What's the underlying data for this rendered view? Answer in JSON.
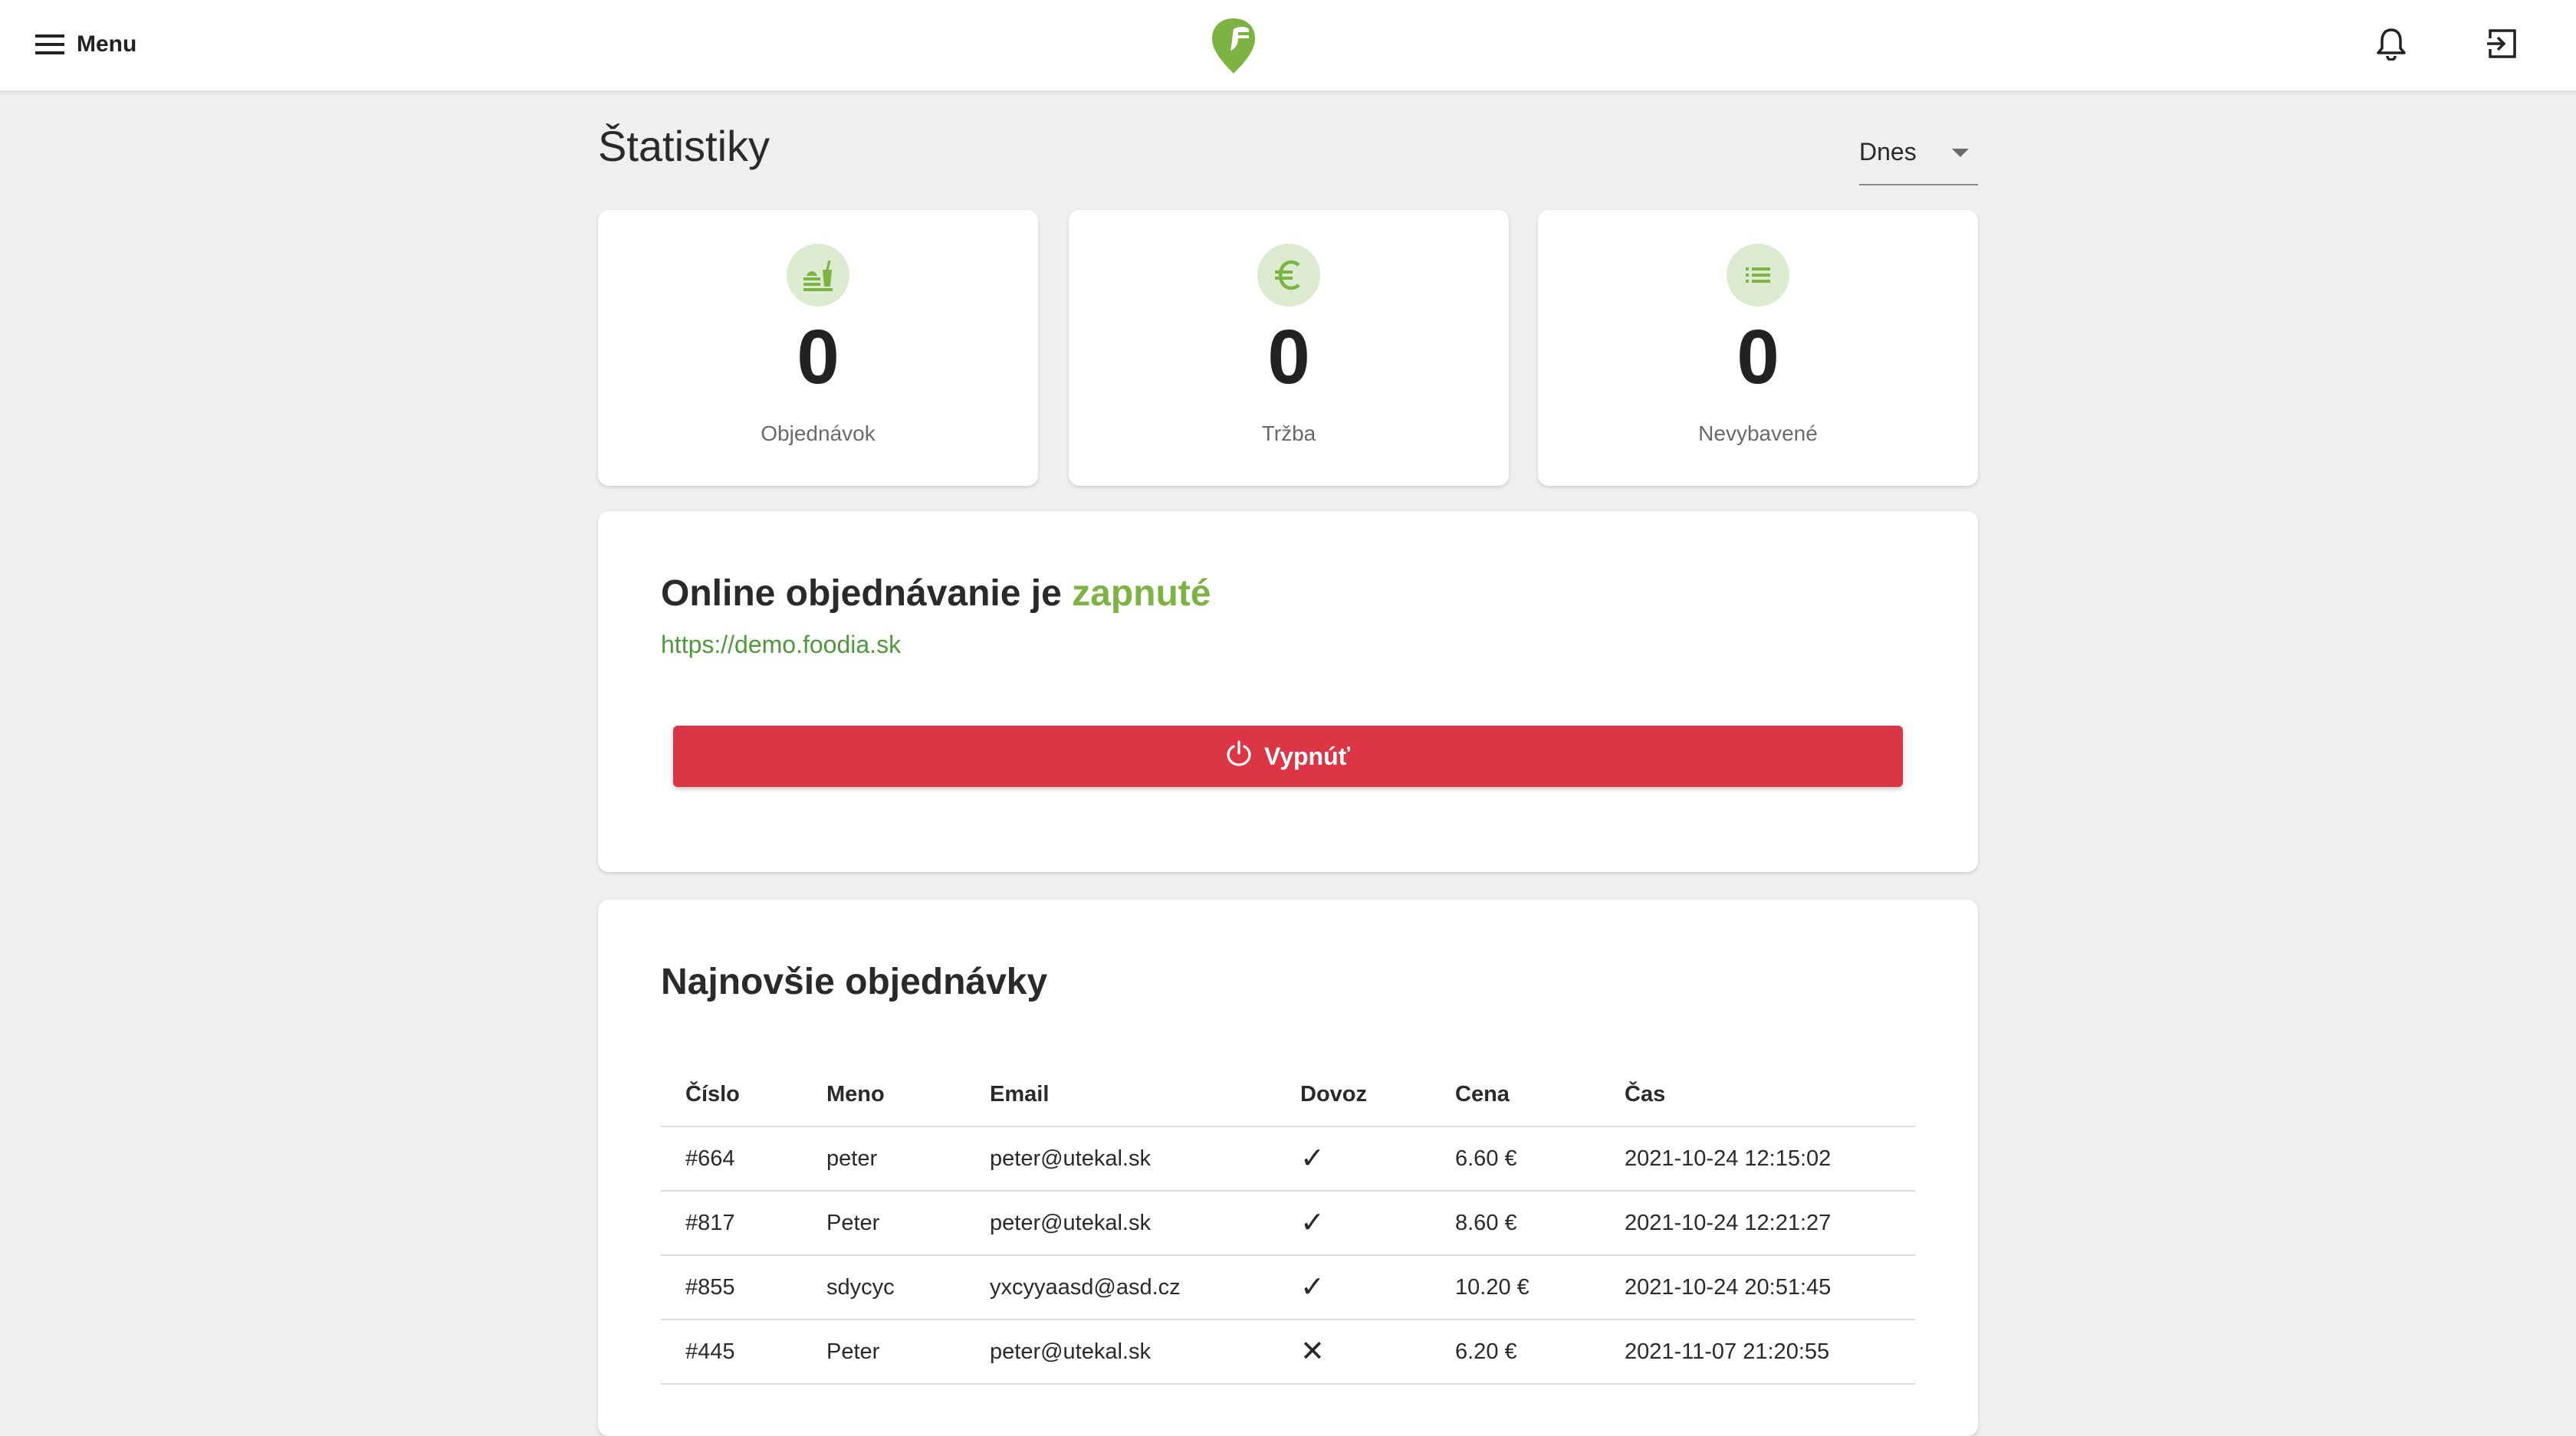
{
  "header": {
    "menu_label": "Menu",
    "logo_icon": "leaf-fork-logo",
    "notifications_icon": "bell-icon",
    "logout_icon": "logout-icon"
  },
  "page": {
    "title": "Štatistiky",
    "period": {
      "selected": "Dnes"
    }
  },
  "stats": [
    {
      "icon": "food-icon",
      "value": "0",
      "label": "Objednávok"
    },
    {
      "icon": "euro-icon",
      "value": "0",
      "label": "Tržba"
    },
    {
      "icon": "list-icon",
      "value": "0",
      "label": "Nevybavené"
    }
  ],
  "online": {
    "heading_prefix": "Online objednávanie je",
    "status": "zapnuté",
    "link": "https://demo.foodia.sk",
    "button_label": "Vypnúť"
  },
  "orders": {
    "heading": "Najnovšie objednávky",
    "columns": [
      "Číslo",
      "Meno",
      "Email",
      "Dovoz",
      "Cena",
      "Čas"
    ],
    "rows": [
      {
        "number": "#664",
        "name": "peter",
        "email": "peter@utekal.sk",
        "delivery": "✓",
        "price": "6.60 €",
        "time": "2021-10-24 12:15:02"
      },
      {
        "number": "#817",
        "name": "Peter",
        "email": "peter@utekal.sk",
        "delivery": "✓",
        "price": "8.60 €",
        "time": "2021-10-24 12:21:27"
      },
      {
        "number": "#855",
        "name": "sdycyc",
        "email": "yxcyyaasd@asd.cz",
        "delivery": "✓",
        "price": "10.20 €",
        "time": "2021-10-24 20:51:45"
      },
      {
        "number": "#445",
        "name": "Peter",
        "email": "peter@utekal.sk",
        "delivery": "✕",
        "price": "6.20 €",
        "time": "2021-11-07 21:20:55"
      }
    ]
  },
  "colors": {
    "accent_green": "#7cb342",
    "danger_red": "#dc3545",
    "icon_bg": "#dcebcf"
  }
}
